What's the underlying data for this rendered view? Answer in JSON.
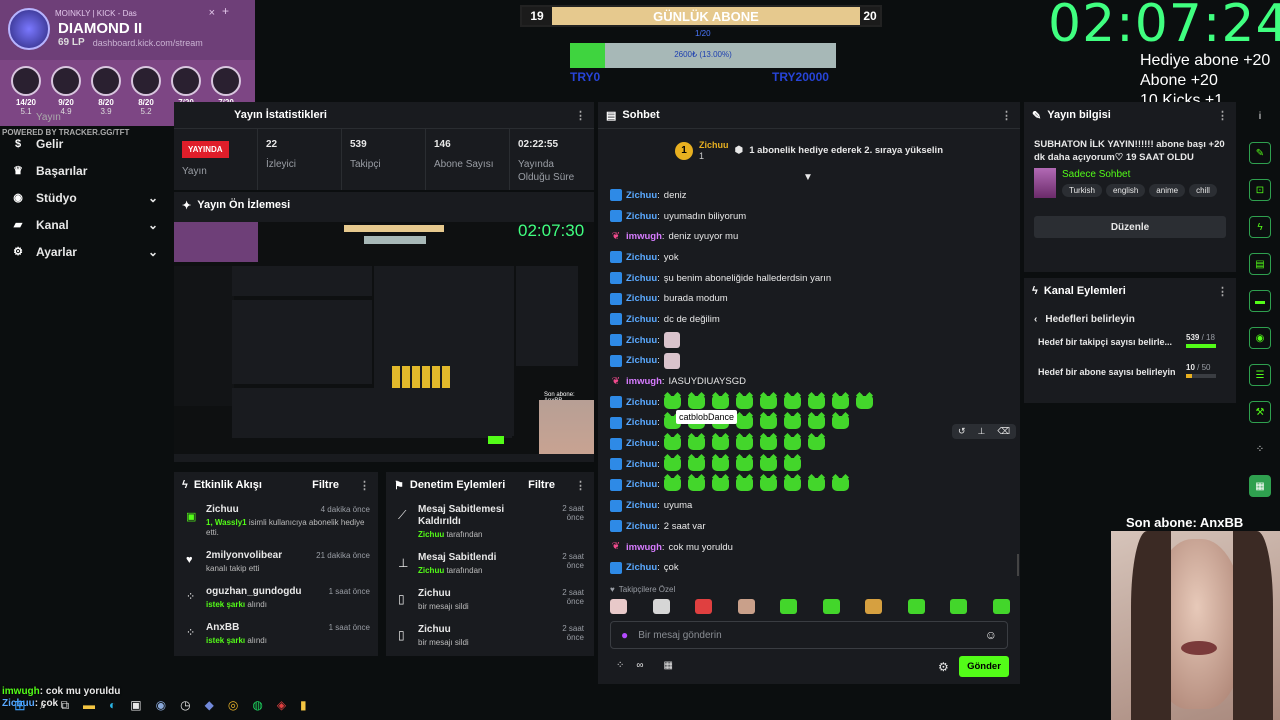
{
  "browser": {
    "tab_title": "MOINKLY | KICK - Das",
    "tab_close": "×",
    "tab_new": "+",
    "url": "dashboard.kick.com/stream"
  },
  "rank": {
    "tier": "DIAMOND II",
    "lp": "69 LP"
  },
  "tft": {
    "champs": [
      {
        "count": "14/20",
        "val": "5.1"
      },
      {
        "count": "9/20",
        "val": "4.9"
      },
      {
        "count": "8/20",
        "val": "3.9"
      },
      {
        "count": "8/20",
        "val": "5.2"
      },
      {
        "count": "7/20",
        "val": "4.6"
      },
      {
        "count": "7/20",
        "val": "4.8"
      }
    ],
    "powered": "POWERED BY TRACKER.GG/TFT"
  },
  "goal": {
    "left": "19",
    "title": "GÜNLÜK ABONE",
    "right": "20",
    "sub_left": "1/20",
    "bar_label": "2600₺ (13.00%)",
    "min": "TRY0",
    "max": "TRY20000",
    "fraction": 0.13
  },
  "clock": "02:07:24",
  "sub_rules": [
    "Hediye abone +20",
    "Abone +20",
    "10 Kicks +1",
    "Takip +1"
  ],
  "sidebar": {
    "items": [
      {
        "label": "Yayın"
      },
      {
        "label": "Gelir"
      },
      {
        "label": "Başarılar"
      },
      {
        "label": "Stüdyo"
      },
      {
        "label": "Kanal"
      },
      {
        "label": "Ayarlar"
      }
    ]
  },
  "stats": {
    "title": "Yayın İstatistikleri",
    "live": "YAYINDA",
    "live_label": "Yayın",
    "cells": [
      {
        "value": "22",
        "label": "İzleyici"
      },
      {
        "value": "539",
        "label": "Takipçi"
      },
      {
        "value": "146",
        "label": "Abone Sayısı"
      },
      {
        "value": "02:22:55",
        "label": "Yayında Olduğu Süre"
      }
    ]
  },
  "preview": {
    "title": "Yayın Ön İzlemesi",
    "clock": "02:07:30",
    "sub": "Son abone: AnxBB"
  },
  "activity": {
    "title": "Etkinlik Akışı",
    "filter": "Filtre",
    "items": [
      {
        "name": "Zichuu",
        "time": "4 dakika önce",
        "desc1": "1, Wassly1",
        "desc2": " isimli kullanıcıya abonelik hediye etti."
      },
      {
        "name": "2milyonvolibear",
        "time": "21 dakika önce",
        "desc1": "",
        "desc2": "kanalı takip etti"
      },
      {
        "name": "oguzhan_gundogdu",
        "time": "1 saat önce",
        "desc1": "istek şarkı",
        "desc2": " alındı"
      },
      {
        "name": "AnxBB",
        "time": "1 saat önce",
        "desc1": "istek şarkı",
        "desc2": " alındı"
      }
    ]
  },
  "moderation": {
    "title": "Denetim Eylemleri",
    "filter": "Filtre",
    "items": [
      {
        "title": "Mesaj Sabitlemesi Kaldırıldı",
        "by": "Zichuu",
        "by_suffix": " tarafından",
        "time": "2 saat önce"
      },
      {
        "title": "Mesaj Sabitlendi",
        "by": "Zichuu",
        "by_suffix": " tarafından",
        "time": "2 saat önce"
      },
      {
        "title": "Zichuu",
        "by": "",
        "by_suffix": "bir mesajı sildi",
        "time": "2 saat önce"
      },
      {
        "title": "Zichuu",
        "by": "",
        "by_suffix": "bir mesajı sildi",
        "time": "2 saat önce"
      }
    ]
  },
  "chat": {
    "title": "Sohbet",
    "gifter": {
      "name": "Zichuu",
      "count": "1",
      "text": "1 abonelik hediye ederek 2. sıraya yükselin"
    },
    "messages": [
      {
        "user": "Zichuu",
        "text": "deniz",
        "emotes": 0
      },
      {
        "user": "Zichuu",
        "text": "uyumadın biliyorum",
        "emotes": 0
      },
      {
        "user": "imwugh",
        "text": "deniz uyuyor mu",
        "emotes": 0
      },
      {
        "user": "Zichuu",
        "text": "yok",
        "emotes": 0
      },
      {
        "user": "Zichuu",
        "text": "şu benim aboneliğide hallederdsin yarın",
        "emotes": 0
      },
      {
        "user": "Zichuu",
        "text": "burada modum",
        "emotes": 0
      },
      {
        "user": "Zichuu",
        "text": "dc de değilim",
        "emotes": 0
      },
      {
        "user": "Zichuu",
        "text": "",
        "emotes": 0,
        "img": true
      },
      {
        "user": "Zichuu",
        "text": "",
        "emotes": 0,
        "img": true
      },
      {
        "user": "imwugh",
        "text": "IASUYDIUAYSGD",
        "emotes": 0
      },
      {
        "user": "Zichuu",
        "text": "",
        "emotes": 9
      },
      {
        "user": "Zichuu",
        "text": "",
        "emotes": 8
      },
      {
        "user": "Zichuu",
        "text": "",
        "emotes": 7
      },
      {
        "user": "Zichuu",
        "text": "",
        "emotes": 6
      },
      {
        "user": "Zichuu",
        "text": "",
        "emotes": 8
      },
      {
        "user": "Zichuu",
        "text": "uyuma",
        "emotes": 0
      },
      {
        "user": "Zichuu",
        "text": "2 saat var",
        "emotes": 0
      },
      {
        "user": "imwugh",
        "text": "cok mu yoruldu",
        "emotes": 0
      },
      {
        "user": "Zichuu",
        "text": "çok",
        "emotes": 0
      }
    ],
    "tooltip": "catblobDance",
    "followers_only": "Takipçilere Özel",
    "placeholder": "Bir mesaj gönderin",
    "send": "Gönder"
  },
  "info": {
    "title": "Yayın bilgisi",
    "stream_title": "SUBHATON İLK YAYIN!!!!!! abone başı +20 dk daha açıyorum♡ 19 SAAT OLDU",
    "category": "Sadece Sohbet",
    "tags": [
      "Turkish",
      "english",
      "anime",
      "chill"
    ],
    "edit": "Düzenle"
  },
  "actions": {
    "title": "Kanal Eylemleri",
    "goals_title": "Hedefleri belirleyin",
    "goals": [
      {
        "label": "Hedef bir takipçi sayısı belirle...",
        "cur": "539",
        "max": " / 18",
        "fraction": 1.0
      },
      {
        "label": "Hedef bir abone sayısı belirleyin",
        "cur": "10",
        "max": " / 50",
        "fraction": 0.2
      }
    ]
  },
  "cam": {
    "title": "Son abone: AnxBB"
  },
  "overlay_chat": [
    {
      "user": "imwugh",
      "text": ": cok mu yoruldu"
    },
    {
      "user": "Zichuu",
      "text": ": çok"
    }
  ],
  "colors": {
    "accent": "#53fc18",
    "zichuu": "#5aa9ff",
    "imwugh": "#d77cff",
    "panel": "#191b1f"
  }
}
